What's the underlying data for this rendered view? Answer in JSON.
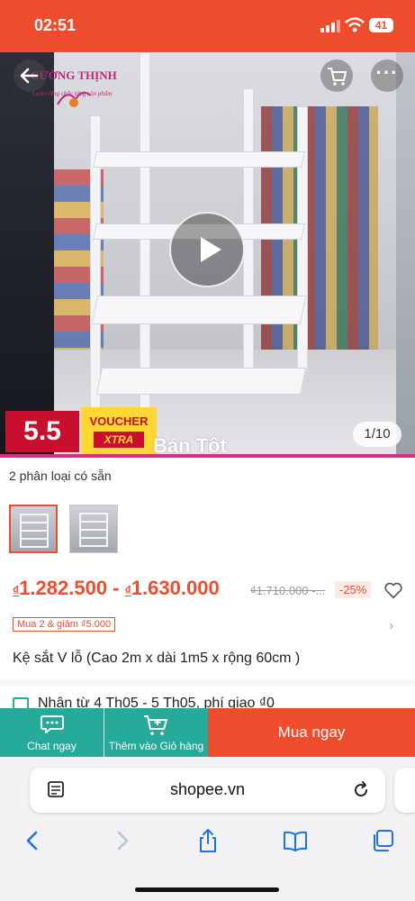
{
  "status_bar": {
    "time": "02:51",
    "battery": "41"
  },
  "hero": {
    "logo_title": "CƯỜNG THỊNH",
    "logo_sub": "Luôn vững chắc từng sản phẩm",
    "badge_55": "5.5",
    "voucher_top": "VOUCHER",
    "voucher_bottom": "XTRA",
    "counter": "1/10",
    "watermark": "Bán Tốt"
  },
  "variants": {
    "label": "2 phân loại có sẵn"
  },
  "price": {
    "currency": "₫",
    "range_low": "1.282.500",
    "separator": " - ",
    "range_high": "1.630.000",
    "old_price": "₫1.710.000 -...",
    "discount": "-25%"
  },
  "promo": {
    "tag": "Mua 2 & giảm ₫5.000"
  },
  "product": {
    "title": "Kệ sắt V lỗ (Cao 2m x dài 1m5 x rộng 60cm )",
    "shipping": "Nhận từ 4 Th05 - 5 Th05, phí giao ₫0"
  },
  "actions": {
    "chat_label": "Chat ngay",
    "addcart_label": "Thêm vào Giỏ hàng",
    "buynow_label": "Mua ngay"
  },
  "browser": {
    "url": "shopee.vn"
  },
  "colors": {
    "brand": "#ee4d2d",
    "teal": "#26aa99",
    "promo_red": "#c8102e",
    "voucher_yellow": "#fdd835"
  }
}
